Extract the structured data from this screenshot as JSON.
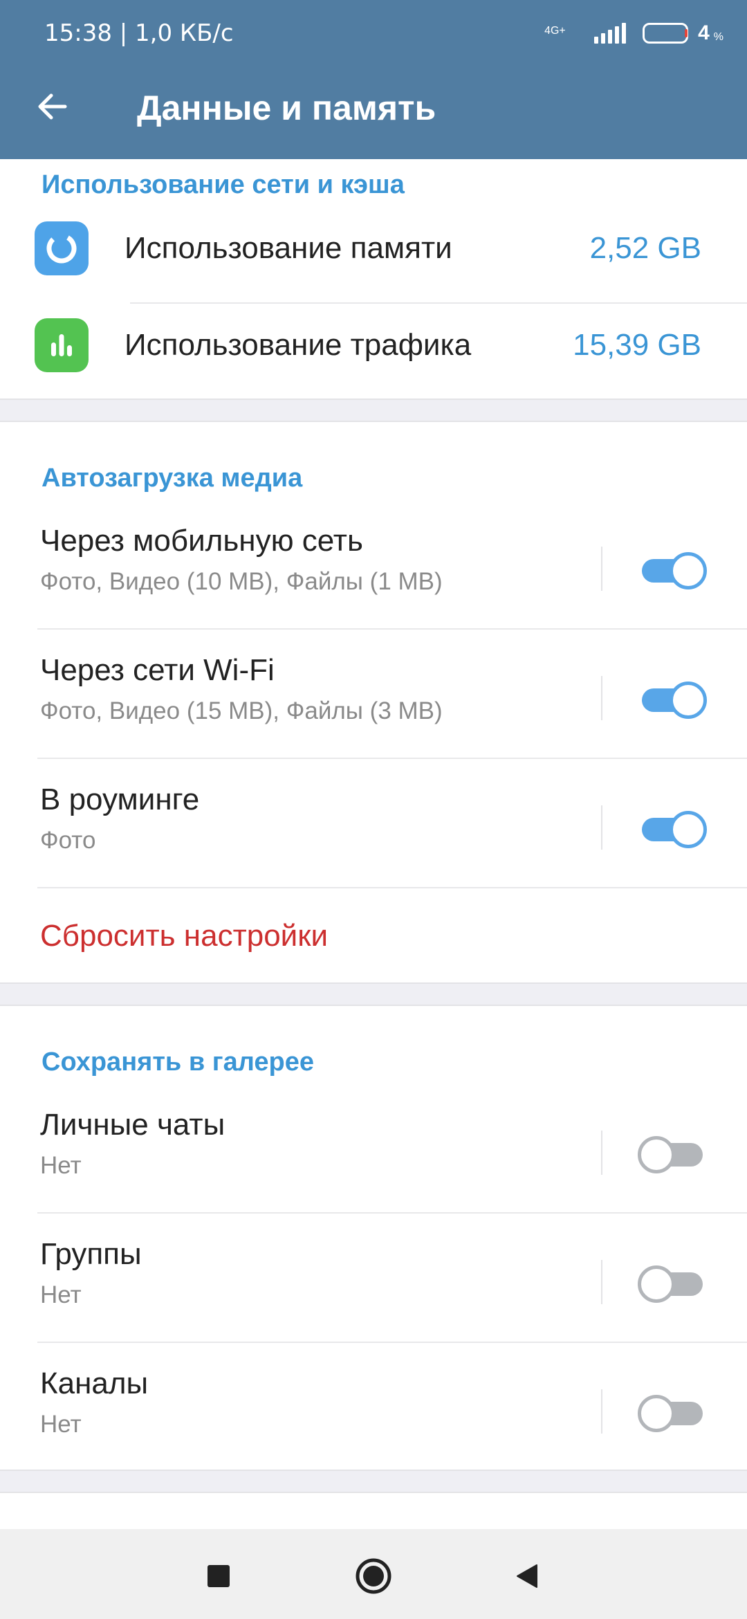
{
  "status_bar": {
    "time": "15:38 | 1,0 КБ/с",
    "network": "4G+",
    "battery": "4",
    "battery_unit": "%"
  },
  "app_bar": {
    "title": "Данные и память",
    "back_icon": "arrow-left-icon"
  },
  "network_cache": {
    "header": "Использование сети и кэша",
    "items": [
      {
        "label": "Использование памяти",
        "value": "2,52 GB",
        "icon": "storage-ring-icon",
        "icon_color": "#4ea3e8"
      },
      {
        "label": "Использование трафика",
        "value": "15,39 GB",
        "icon": "bar-chart-icon",
        "icon_color": "#53c351"
      }
    ]
  },
  "auto_download": {
    "header": "Автозагрузка медиа",
    "items": [
      {
        "title": "Через мобильную сеть",
        "subtitle": "Фото, Видео (10 MB), Файлы (1 MB)",
        "enabled": true
      },
      {
        "title": "Через сети Wi-Fi",
        "subtitle": "Фото, Видео (15 MB), Файлы (3 MB)",
        "enabled": true
      },
      {
        "title": "В роуминге",
        "subtitle": "Фото",
        "enabled": true
      }
    ],
    "reset_label": "Сбросить настройки"
  },
  "save_to_gallery": {
    "header": "Сохранять в галерее",
    "items": [
      {
        "title": "Личные чаты",
        "subtitle": "Нет",
        "enabled": false
      },
      {
        "title": "Группы",
        "subtitle": "Нет",
        "enabled": false
      },
      {
        "title": "Каналы",
        "subtitle": "Нет",
        "enabled": false
      }
    ]
  },
  "colors": {
    "app_bar": "#517da2",
    "accent": "#3a95d5",
    "switch_on": "#58a6e8",
    "switch_off": "#b3b6ba",
    "destructive": "#cc2f2f"
  },
  "nav_bar": {
    "recent_icon": "square-icon",
    "home_icon": "circle-icon",
    "back_icon": "triangle-back-icon"
  }
}
